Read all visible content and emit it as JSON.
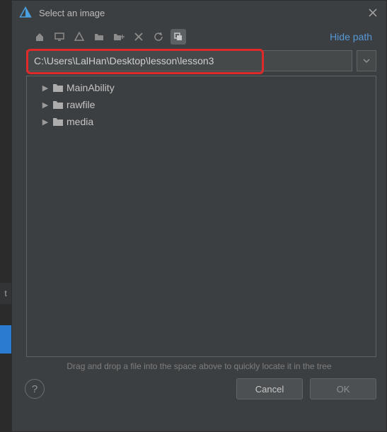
{
  "titlebar": {
    "title": "Select an image"
  },
  "toolbar": {
    "hide_path": "Hide path"
  },
  "path": {
    "value": "C:\\Users\\LalHan\\Desktop\\lesson\\lesson3"
  },
  "tree": {
    "items": [
      {
        "label": "MainAbility"
      },
      {
        "label": "rawfile"
      },
      {
        "label": "media"
      }
    ]
  },
  "hint": "Drag and drop a file into the space above to quickly locate it in the tree",
  "footer": {
    "help": "?",
    "cancel": "Cancel",
    "ok": "OK"
  }
}
